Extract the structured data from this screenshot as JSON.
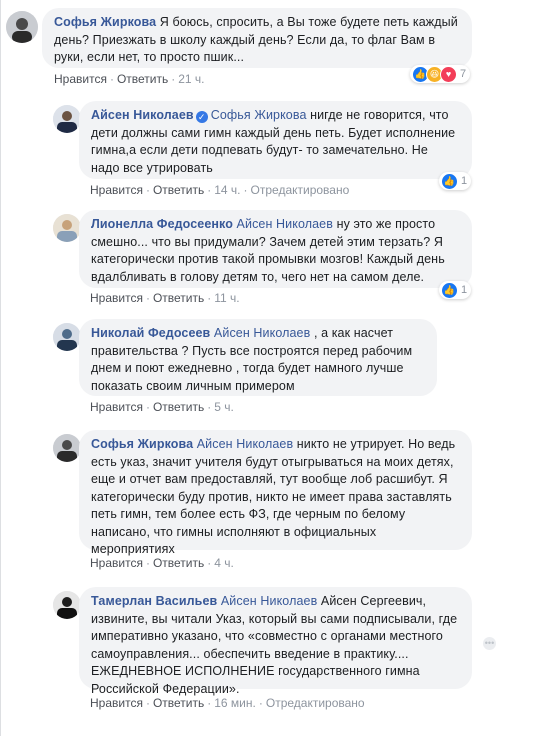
{
  "comments": [
    {
      "author": "Софья Жиркова",
      "mention": "",
      "text": "Я боюсь, спросить, а Вы тоже будете петь каждый день? Приезжать в школу каждый день? Если да, то флаг Вам в руки, если нет, то просто пшик...",
      "actions": {
        "like": "Нравится",
        "reply": "Ответить",
        "time": "21 ч.",
        "edited": ""
      },
      "reactions": {
        "icons": [
          "like-icon",
          "haha-icon",
          "love-icon"
        ],
        "count": "7"
      }
    },
    {
      "author": "Айсен Николаев",
      "verified": true,
      "mention": "Софья Жиркова",
      "text": "нигде не говорится, что дети должны сами гимн каждый день петь. Будет исполнение гимна,а если дети подпевать будут- то замечательно. Не надо все утрировать",
      "actions": {
        "like": "Нравится",
        "reply": "Ответить",
        "time": "14 ч.",
        "edited": "Отредактировано"
      },
      "reactions": {
        "icons": [
          "like-icon"
        ],
        "count": "1"
      }
    },
    {
      "author": "Лионелла Федосеенко",
      "mention": "Айсен Николаев",
      "text": "ну это же просто смешно... что вы придумали? Зачем детей этим терзать? Я категорически против такой промывки мозгов! Каждый день вдалбливать в голову детям то, чего нет на самом деле.",
      "actions": {
        "like": "Нравится",
        "reply": "Ответить",
        "time": "11 ч.",
        "edited": ""
      },
      "reactions": {
        "icons": [
          "like-icon"
        ],
        "count": "1"
      }
    },
    {
      "author": "Николай Федосеев",
      "mention": "Айсен Николаев",
      "text": ", а как насчет правительства ? Пусть все построятся перед рабочим днем и поют ежедневно , тогда будет намного лучше показать своим личным примером",
      "actions": {
        "like": "Нравится",
        "reply": "Ответить",
        "time": "5 ч.",
        "edited": ""
      }
    },
    {
      "author": "Софья Жиркова",
      "mention": "Айсен Николаев",
      "text": "никто не утрирует. Но ведь есть указ, значит учителя будут отыгрываться на моих детях, еще и отчет вам предоставляй, тут вообще лоб расшибут. Я категорически буду против, никто не имеет права заставлять петь гимн, тем более есть ФЗ, где черным по белому написано, что гимны исполняют в официальных мероприятиях",
      "actions": {
        "like": "Нравится",
        "reply": "Ответить",
        "time": "4 ч.",
        "edited": ""
      }
    },
    {
      "author": "Тамерлан Васильев",
      "mention": "Айсен Николаев",
      "text": "Айсен Сергеевич, извините, вы читали Указ, который вы сами подписывали, где императивно указано, что «совместно с органами местного самоуправления... обеспечить введение в практику.... ЕЖЕДНЕВНОЕ ИСПОЛНЕНИЕ государственного гимна Российской Федерации».",
      "actions": {
        "like": "Нравится",
        "reply": "Ответить",
        "time": "16 мин.",
        "edited": "Отредактировано"
      }
    }
  ],
  "colors": {
    "author": "#385898",
    "bubble": "#f2f3f5",
    "meta": "#8d949e",
    "like": "#1877f2"
  }
}
